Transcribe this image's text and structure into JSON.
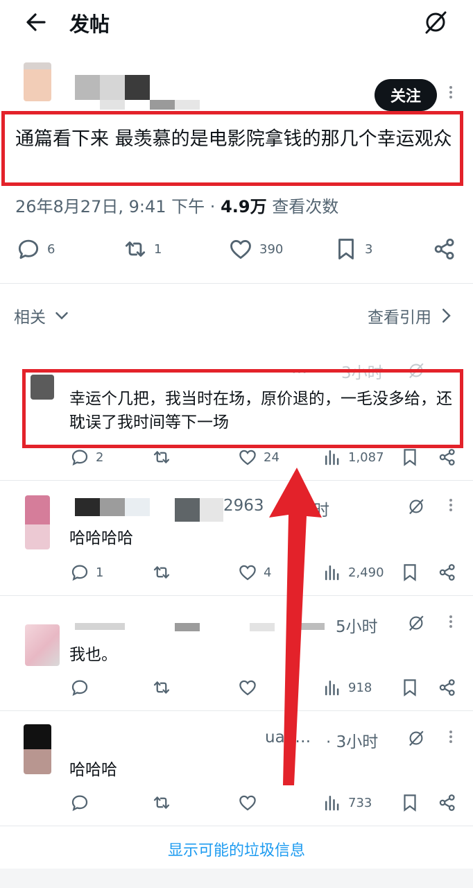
{
  "header": {
    "title": "发帖"
  },
  "post": {
    "follow_label": "关注",
    "text": "通篇看下来 最羡慕的是电影院拿钱的那几个幸运观众",
    "timestamp": "26年8月27日, 9:41 下午",
    "separator": "·",
    "views_count": "4.9万",
    "views_label": "查看次数",
    "stats": {
      "replies": "6",
      "reposts": "1",
      "likes": "390",
      "bookmarks": "3"
    }
  },
  "section": {
    "related_label": "相关",
    "quotes_label": "查看引用"
  },
  "replies": [
    {
      "partial_handle": "…",
      "time": "3小时",
      "text": "幸运个几把，我当时在场，原价退的，一毛没多给，还耽误了我时间等下一场",
      "stats": {
        "replies": "2",
        "likes": "24",
        "views": "1,087"
      }
    },
    {
      "partial_handle": "2963",
      "time": "时",
      "text": "哈哈哈哈",
      "stats": {
        "replies": "1",
        "likes": "4",
        "views": "2,490"
      }
    },
    {
      "partial_handle": "",
      "time": "5小时",
      "text": "我也。",
      "stats": {
        "replies": "",
        "likes": "",
        "views": "918"
      }
    },
    {
      "partial_handle": "uan…",
      "time": "· 3小时",
      "text": "哈哈哈",
      "stats": {
        "replies": "",
        "likes": "",
        "views": "733"
      }
    }
  ],
  "footer": {
    "spam_link": "显示可能的垃圾信息"
  },
  "colors": {
    "highlight_red": "#e3222a",
    "link_blue": "#1d9bf0",
    "muted_grey": "#536471",
    "text_dark": "#0f1419"
  }
}
